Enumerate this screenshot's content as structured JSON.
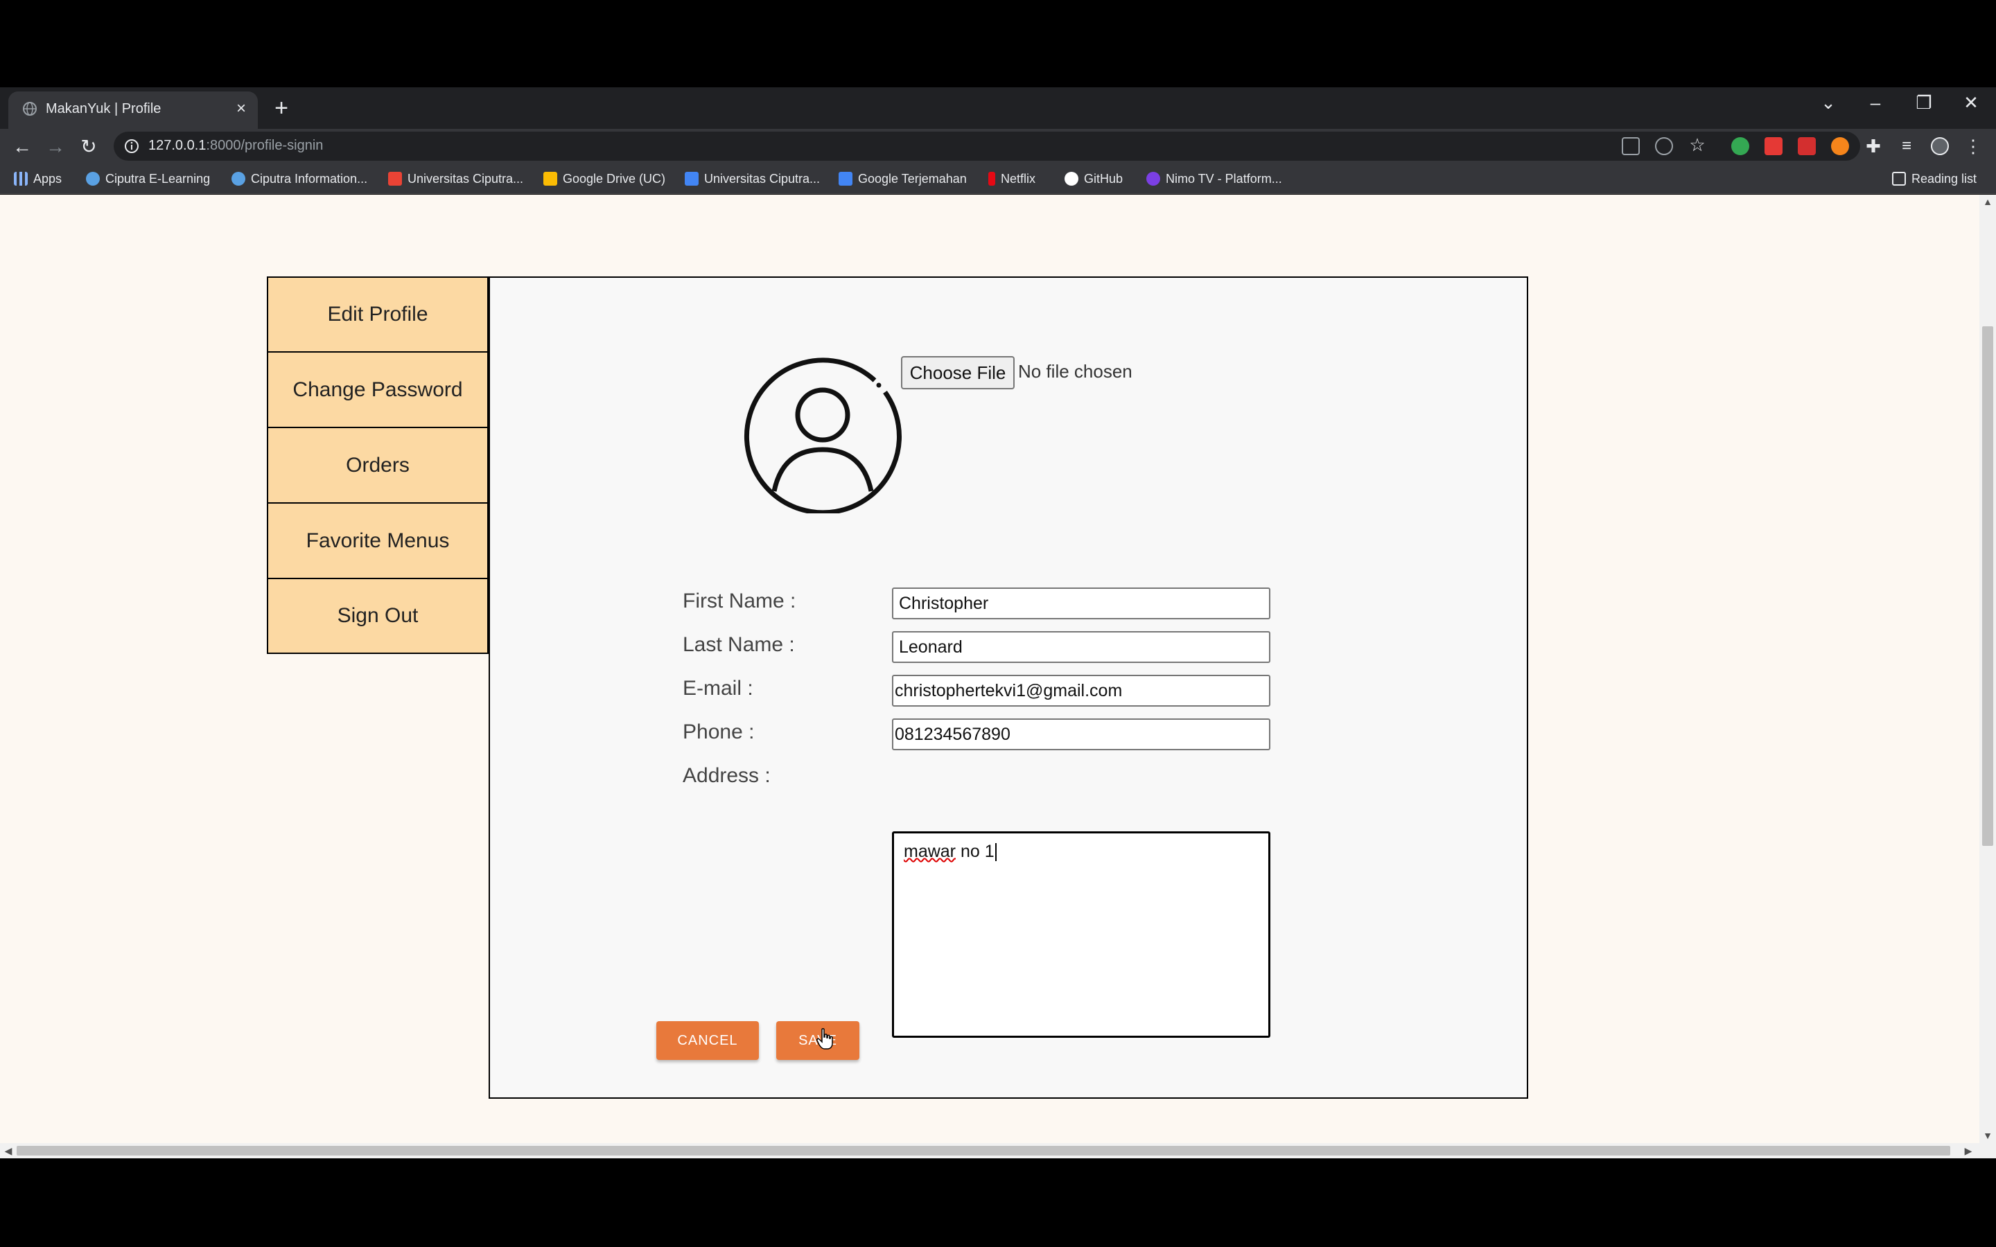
{
  "browser": {
    "tab_title": "MakanYuk | Profile",
    "tab_close": "×",
    "new_tab": "+",
    "url_host": "127.0.0.1",
    "url_rest": ":8000/profile-signin",
    "reading_list": "Reading list",
    "bookmarks": [
      {
        "label": "Apps",
        "color": "#8ab4f8"
      },
      {
        "label": "Ciputra E-Learning",
        "color": "#5aa1e3"
      },
      {
        "label": "Ciputra Information...",
        "color": "#5aa1e3"
      },
      {
        "label": "Universitas Ciputra...",
        "color": "#ea4335"
      },
      {
        "label": "Google Drive (UC)",
        "color": "#fbbc04"
      },
      {
        "label": "Universitas Ciputra...",
        "color": "#4285f4"
      },
      {
        "label": "Google Terjemahan",
        "color": "#4285f4"
      },
      {
        "label": "Netflix",
        "color": "#e50914"
      },
      {
        "label": "GitHub",
        "color": "#ffffff"
      },
      {
        "label": "Nimo TV - Platform...",
        "color": "#7b3fe4"
      }
    ]
  },
  "sidebar": {
    "items": [
      {
        "label": "Edit Profile"
      },
      {
        "label": "Change Password"
      },
      {
        "label": "Orders"
      },
      {
        "label": "Favorite Menus"
      },
      {
        "label": "Sign Out"
      }
    ]
  },
  "profile_form": {
    "file_button": "Choose File",
    "file_status": "No file chosen",
    "first_name_label": "First Name :",
    "first_name_value": "Christopher",
    "last_name_label": "Last Name :",
    "last_name_value": "Leonard",
    "email_label": "E-mail :",
    "email_value": "christophertekvi1@gmail.com",
    "phone_label": "Phone :",
    "phone_value": "081234567890",
    "address_label": "Address :",
    "address_word1": "mawar",
    "address_rest": " no 1",
    "cancel_label": "CANCEL",
    "save_label": "SAVE"
  },
  "back_to_top_icon": "double-chevron-up-icon"
}
